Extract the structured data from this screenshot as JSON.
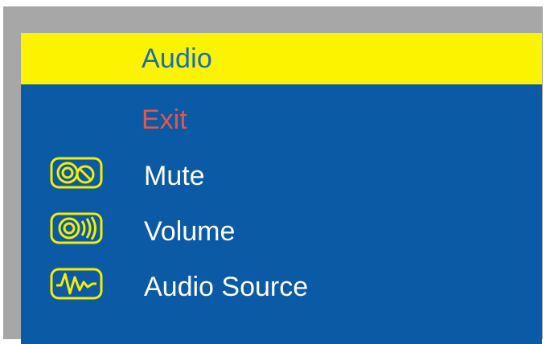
{
  "osd": {
    "title": "Audio",
    "colors": {
      "background": "#0a5aa6",
      "title_bar": "#fbf300",
      "title_text": "#1a6cb4",
      "exit_text": "#e3574a",
      "item_text": "#ffffff",
      "icon_stroke": "#f6ee00",
      "frame": "#a7a7a7"
    },
    "items": [
      {
        "label": "Exit",
        "icon": null
      },
      {
        "label": "Mute",
        "icon": "mute-icon"
      },
      {
        "label": "Volume",
        "icon": "volume-icon"
      },
      {
        "label": "Audio Source",
        "icon": "audio-source-icon"
      }
    ]
  }
}
